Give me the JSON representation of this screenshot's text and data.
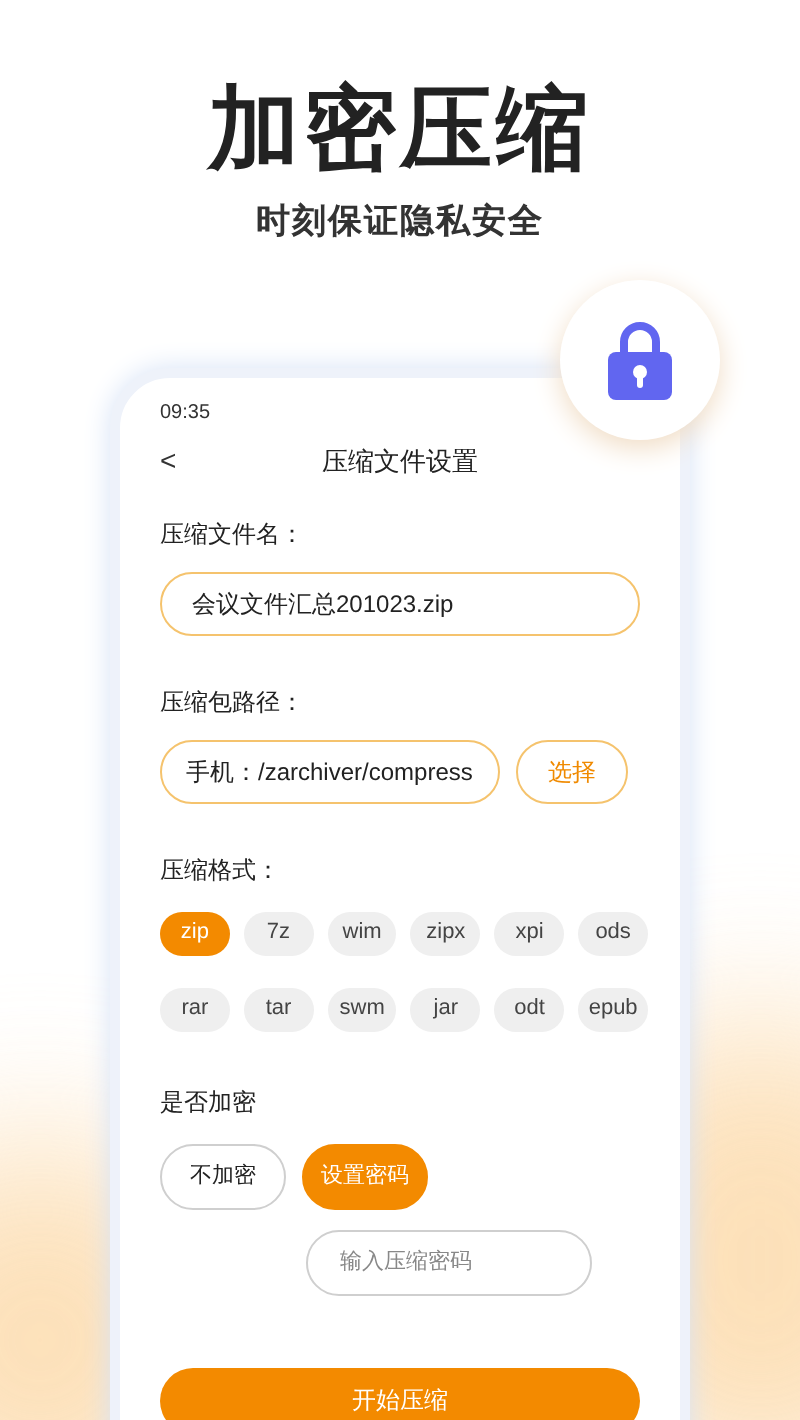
{
  "headline": "加密压缩",
  "subtitle": "时刻保证隐私安全",
  "phone": {
    "status_time": "09:35",
    "back": "<",
    "title": "压缩文件设置",
    "name_label": "压缩文件名：",
    "name_value": "会议文件汇总201023.zip",
    "path_label": "压缩包路径：",
    "path_value": "手机：/zarchiver/compress",
    "choose_button": "选择",
    "format_label": "压缩格式：",
    "formats": [
      {
        "label": "zip",
        "selected": true
      },
      {
        "label": "7z",
        "selected": false
      },
      {
        "label": "wim",
        "selected": false
      },
      {
        "label": "zipx",
        "selected": false
      },
      {
        "label": "xpi",
        "selected": false
      },
      {
        "label": "ods",
        "selected": false
      },
      {
        "label": "rar",
        "selected": false
      },
      {
        "label": "tar",
        "selected": false
      },
      {
        "label": "swm",
        "selected": false
      },
      {
        "label": "jar",
        "selected": false
      },
      {
        "label": "odt",
        "selected": false
      },
      {
        "label": "epub",
        "selected": false
      }
    ],
    "encrypt_label": "是否加密",
    "encrypt_options": [
      {
        "label": "不加密",
        "selected": false
      },
      {
        "label": "设置密码",
        "selected": true
      }
    ],
    "password_placeholder": "输入压缩密码",
    "start_button": "开始压缩"
  }
}
